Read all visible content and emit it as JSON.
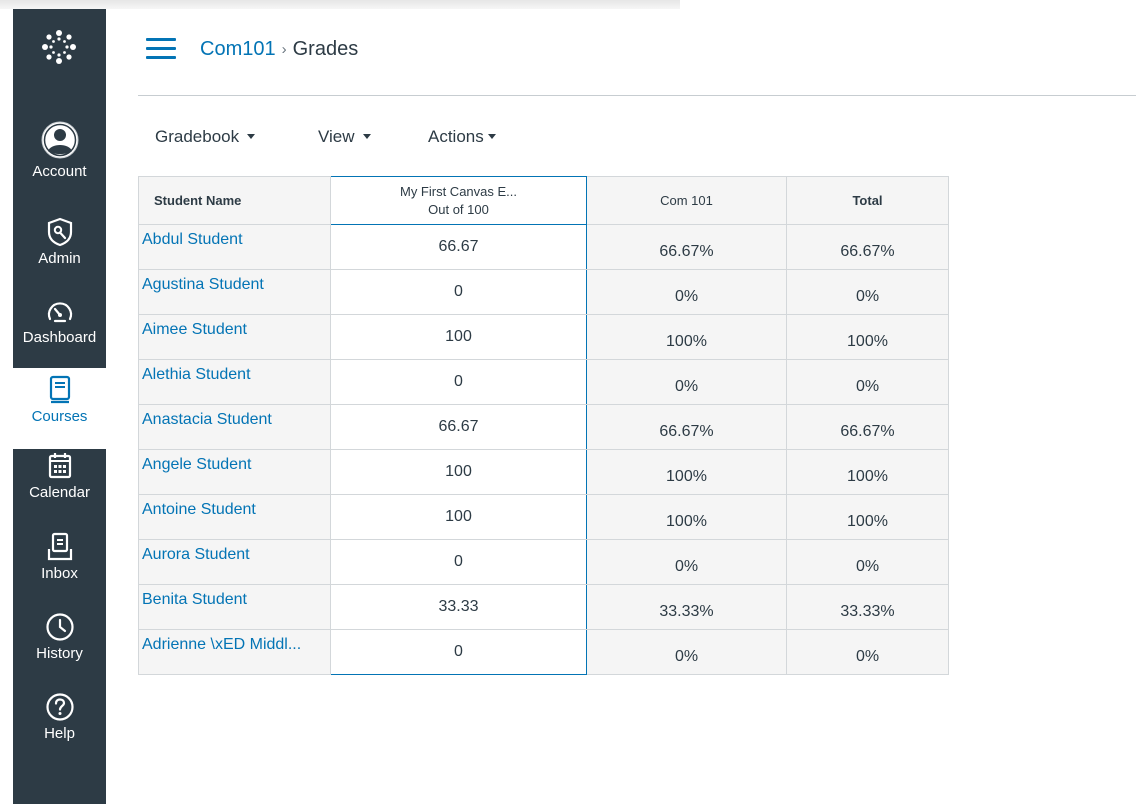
{
  "nav": {
    "items": [
      {
        "key": "account",
        "label": "Account",
        "icon": "account-icon"
      },
      {
        "key": "admin",
        "label": "Admin",
        "icon": "shield-icon"
      },
      {
        "key": "dashboard",
        "label": "Dashboard",
        "icon": "speedometer-icon"
      },
      {
        "key": "courses",
        "label": "Courses",
        "icon": "book-icon",
        "active": true
      },
      {
        "key": "calendar",
        "label": "Calendar",
        "icon": "calendar-icon"
      },
      {
        "key": "inbox",
        "label": "Inbox",
        "icon": "inbox-icon"
      },
      {
        "key": "history",
        "label": "History",
        "icon": "clock-icon"
      },
      {
        "key": "help",
        "label": "Help",
        "icon": "help-icon"
      }
    ]
  },
  "header": {
    "course": "Com101",
    "separator": "›",
    "current": "Grades"
  },
  "toolbar": {
    "gradebook": "Gradebook",
    "view": "View",
    "actions": "Actions"
  },
  "table": {
    "headers": {
      "name": "Student Name",
      "assignment_title": "My First Canvas E...",
      "assignment_points": "Out of 100",
      "group": "Com 101",
      "total": "Total"
    },
    "rows": [
      {
        "name": "Abdul Student",
        "score": "66.67",
        "group": "66.67%",
        "total": "66.67%"
      },
      {
        "name": "Agustina Student",
        "score": "0",
        "group": "0%",
        "total": "0%"
      },
      {
        "name": "Aimee Student",
        "score": "100",
        "group": "100%",
        "total": "100%"
      },
      {
        "name": "Alethia Student",
        "score": "0",
        "group": "0%",
        "total": "0%"
      },
      {
        "name": "Anastacia Student",
        "score": "66.67",
        "group": "66.67%",
        "total": "66.67%"
      },
      {
        "name": "Angele Student",
        "score": "100",
        "group": "100%",
        "total": "100%"
      },
      {
        "name": "Antoine Student",
        "score": "100",
        "group": "100%",
        "total": "100%"
      },
      {
        "name": "Aurora Student",
        "score": "0",
        "group": "0%",
        "total": "0%"
      },
      {
        "name": "Benita Student",
        "score": "33.33",
        "group": "33.33%",
        "total": "33.33%"
      },
      {
        "name": "Adrienne \\xED Middl...",
        "score": "0",
        "group": "0%",
        "total": "0%"
      }
    ]
  },
  "colors": {
    "nav_bg": "#2d3b45",
    "accent": "#0374b5",
    "text": "#2d3b45"
  }
}
